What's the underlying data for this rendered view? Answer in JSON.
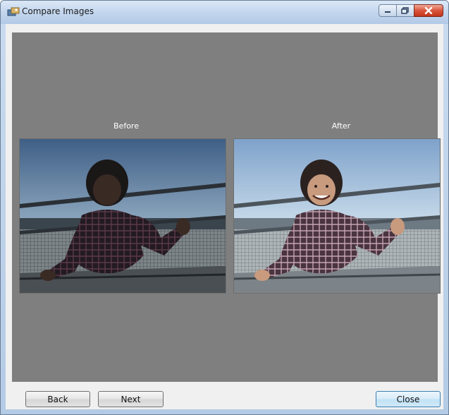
{
  "window": {
    "title": "Compare Images",
    "title_icon": "compare-images-icon",
    "controls": {
      "minimize_icon": "minimize-icon",
      "maximize_icon": "maximize-icon",
      "close_icon": "close-icon"
    }
  },
  "viewer": {
    "background_color": "#7f7f7f",
    "before_label": "Before",
    "after_label": "After"
  },
  "buttons": {
    "back_label": "Back",
    "next_label": "Next",
    "close_label": "Close"
  }
}
